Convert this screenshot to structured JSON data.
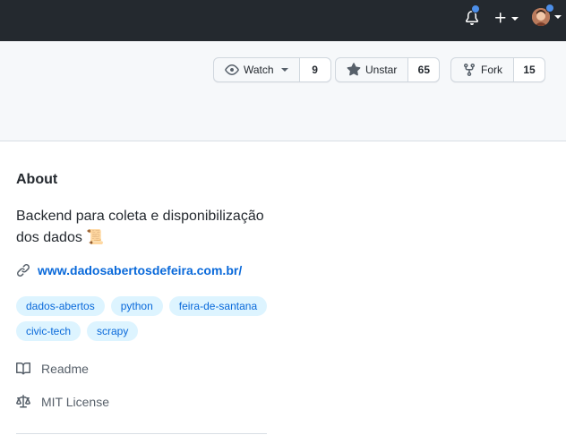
{
  "header": {
    "watch": {
      "label": "Watch",
      "count": "9"
    },
    "star": {
      "label": "Unstar",
      "count": "65"
    },
    "fork": {
      "label": "Fork",
      "count": "15"
    }
  },
  "about": {
    "title": "About",
    "description": "Backend para coleta e disponibilização dos dados 📜",
    "website": "www.dadosabertosdefeira.com.br/",
    "topics": [
      "dados-abertos",
      "python",
      "feira-de-santana",
      "civic-tech",
      "scrapy"
    ],
    "readme_label": "Readme",
    "license_label": "MIT License"
  },
  "colors": {
    "topbar": "#24292f",
    "link": "#0969da",
    "topic_bg": "#ddf4ff",
    "notification_dot": "#4c8ee9"
  },
  "icons": [
    "bell-icon",
    "plus-icon",
    "eye-icon",
    "star-icon",
    "fork-icon",
    "link-icon",
    "book-icon",
    "scale-icon"
  ]
}
